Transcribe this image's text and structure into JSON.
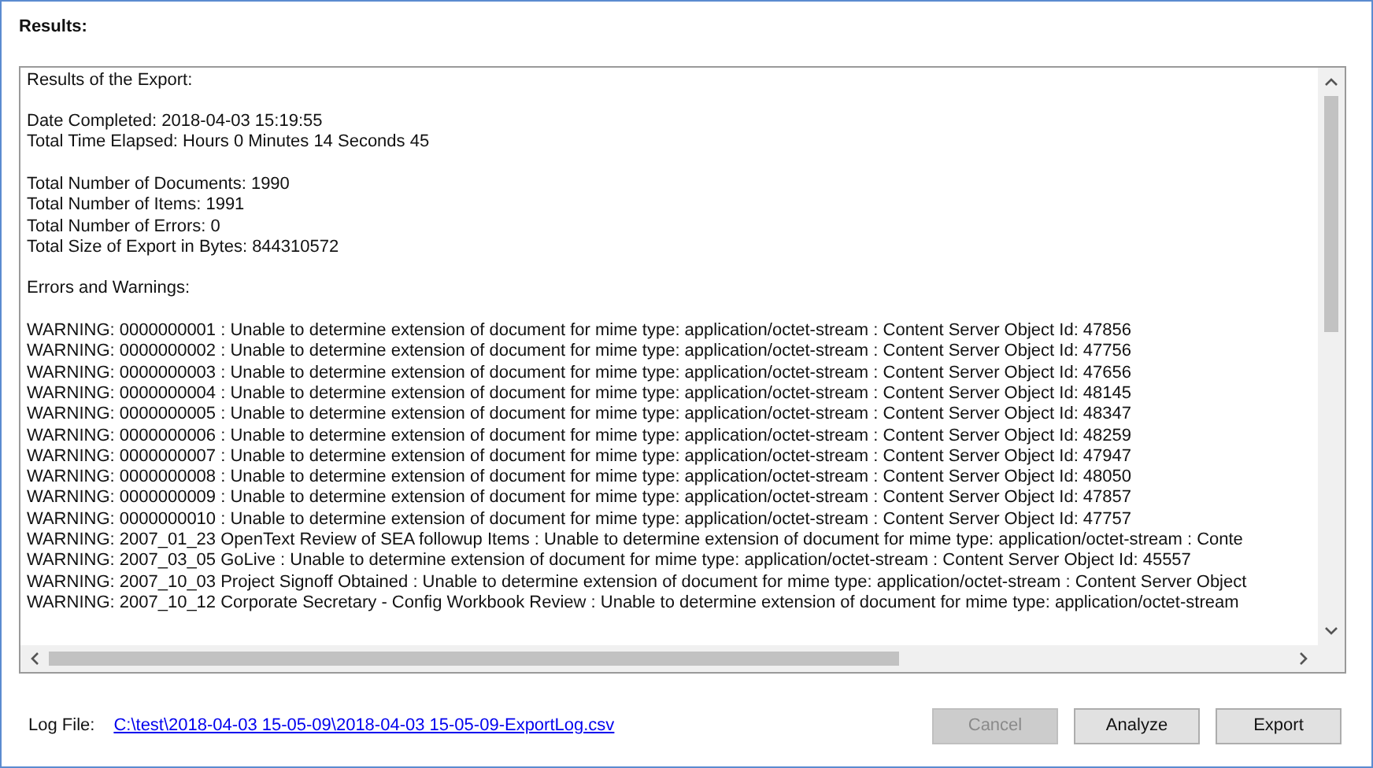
{
  "section_title": "Results:",
  "results_paragraphs": [
    [
      "Results of the Export:"
    ],
    [
      "Date Completed: 2018-04-03 15:19:55",
      "Total Time Elapsed: Hours 0 Minutes 14 Seconds 45"
    ],
    [
      "Total Number of Documents: 1990",
      "Total Number of Items: 1991",
      "Total Number of Errors: 0",
      "Total Size of Export in Bytes: 844310572"
    ],
    [
      "Errors and Warnings:"
    ],
    [
      "WARNING: 0000000001 : Unable to determine extension of document for mime type: application/octet-stream : Content Server Object Id: 47856",
      "WARNING: 0000000002 : Unable to determine extension of document for mime type: application/octet-stream : Content Server Object Id: 47756",
      "WARNING: 0000000003 : Unable to determine extension of document for mime type: application/octet-stream : Content Server Object Id: 47656",
      "WARNING: 0000000004 : Unable to determine extension of document for mime type: application/octet-stream : Content Server Object Id: 48145",
      "WARNING: 0000000005 : Unable to determine extension of document for mime type: application/octet-stream : Content Server Object Id: 48347",
      "WARNING: 0000000006 : Unable to determine extension of document for mime type: application/octet-stream : Content Server Object Id: 48259",
      "WARNING: 0000000007 : Unable to determine extension of document for mime type: application/octet-stream : Content Server Object Id: 47947",
      "WARNING: 0000000008 : Unable to determine extension of document for mime type: application/octet-stream : Content Server Object Id: 48050",
      "WARNING: 0000000009 : Unable to determine extension of document for mime type: application/octet-stream : Content Server Object Id: 47857",
      "WARNING: 0000000010 : Unable to determine extension of document for mime type: application/octet-stream : Content Server Object Id: 47757",
      "WARNING: 2007_01_23 OpenText Review of SEA followup Items : Unable to determine extension of document for mime type: application/octet-stream : Conte",
      "WARNING: 2007_03_05 GoLive : Unable to determine extension of document for mime type: application/octet-stream : Content Server Object Id: 45557",
      "WARNING: 2007_10_03 Project Signoff Obtained : Unable to determine extension of document for mime type: application/octet-stream : Content Server Object",
      "WARNING: 2007_10_12 Corporate Secretary - Config Workbook Review : Unable to determine extension of document for mime type: application/octet-stream"
    ]
  ],
  "log_file": {
    "label": "Log File:",
    "link": "C:\\test\\2018-04-03 15-05-09\\2018-04-03 15-05-09-ExportLog.csv"
  },
  "buttons": [
    {
      "label": "Cancel",
      "disabled": true
    },
    {
      "label": "Analyze",
      "disabled": false
    },
    {
      "label": "Export",
      "disabled": false
    }
  ]
}
